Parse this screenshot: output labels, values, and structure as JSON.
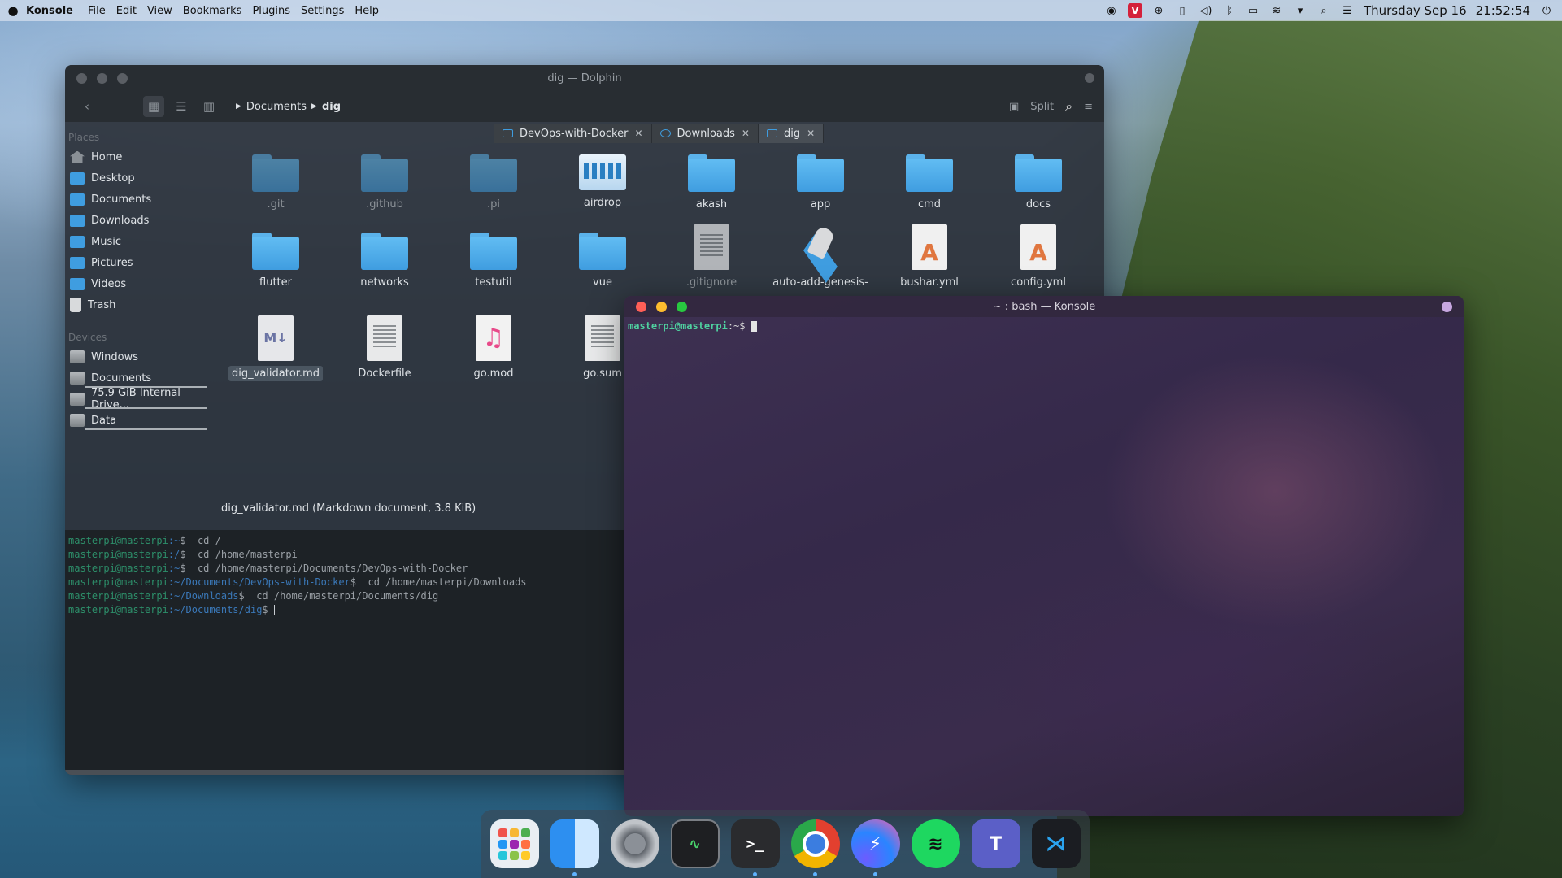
{
  "menubar": {
    "app_name": "Konsole",
    "menus": [
      "File",
      "Edit",
      "View",
      "Bookmarks",
      "Plugins",
      "Settings",
      "Help"
    ],
    "tray_v_label": "V",
    "date": "Thursday Sep 16",
    "time": "21:52:54"
  },
  "dolphin": {
    "title": "dig — Dolphin",
    "breadcrumb": [
      "Documents",
      "dig"
    ],
    "split_label": "Split",
    "places_title": "Places",
    "places": [
      "Home",
      "Desktop",
      "Documents",
      "Downloads",
      "Music",
      "Pictures",
      "Videos",
      "Trash"
    ],
    "devices_title": "Devices",
    "devices": [
      "Windows",
      "Documents",
      "75.9 GiB Internal Drive...",
      "Data"
    ],
    "tabs": [
      "DevOps-with-Docker",
      "Downloads",
      "dig"
    ],
    "files": [
      ".git",
      ".github",
      ".pi",
      "airdrop",
      "akash",
      "app",
      "cmd",
      "docs",
      "flutter",
      "networks",
      "testutil",
      "vue",
      ".gitignore",
      "auto-add-genesis-",
      "bushar.yml",
      "config.yml",
      "dig_validator.md",
      "Dockerfile",
      "go.mod",
      "go.sum"
    ],
    "md_icon_label": "M↓",
    "status": "dig_validator.md (Markdown document, 3.8 KiB)",
    "terminal": [
      {
        "prompt": "masterpi@masterpi",
        "path": ":~",
        "cmd": "$  cd /"
      },
      {
        "prompt": "masterpi@masterpi",
        "path": ":/",
        "cmd": "$  cd /home/masterpi"
      },
      {
        "prompt": "masterpi@masterpi",
        "path": ":~",
        "cmd": "$  cd /home/masterpi/Documents/DevOps-with-Docker"
      },
      {
        "prompt": "masterpi@masterpi",
        "path": ":~/Documents/DevOps-with-Docker",
        "cmd": "$  cd /home/masterpi/Downloads"
      },
      {
        "prompt": "masterpi@masterpi",
        "path": ":~/Downloads",
        "cmd": "$  cd /home/masterpi/Documents/dig"
      },
      {
        "prompt": "masterpi@masterpi",
        "path": ":~/Documents/dig",
        "cmd": "$ "
      }
    ]
  },
  "konsole": {
    "title": "~ : bash — Konsole",
    "prompt_user": "masterpi@masterpi",
    "prompt_path": ":~$"
  },
  "dock": {
    "apps": [
      "launchpad",
      "finder",
      "system-preferences",
      "activity-monitor",
      "terminal",
      "chrome",
      "messenger",
      "spotify",
      "teams",
      "vscode"
    ],
    "terminal_glyph": ">_",
    "teams_glyph": "T"
  }
}
